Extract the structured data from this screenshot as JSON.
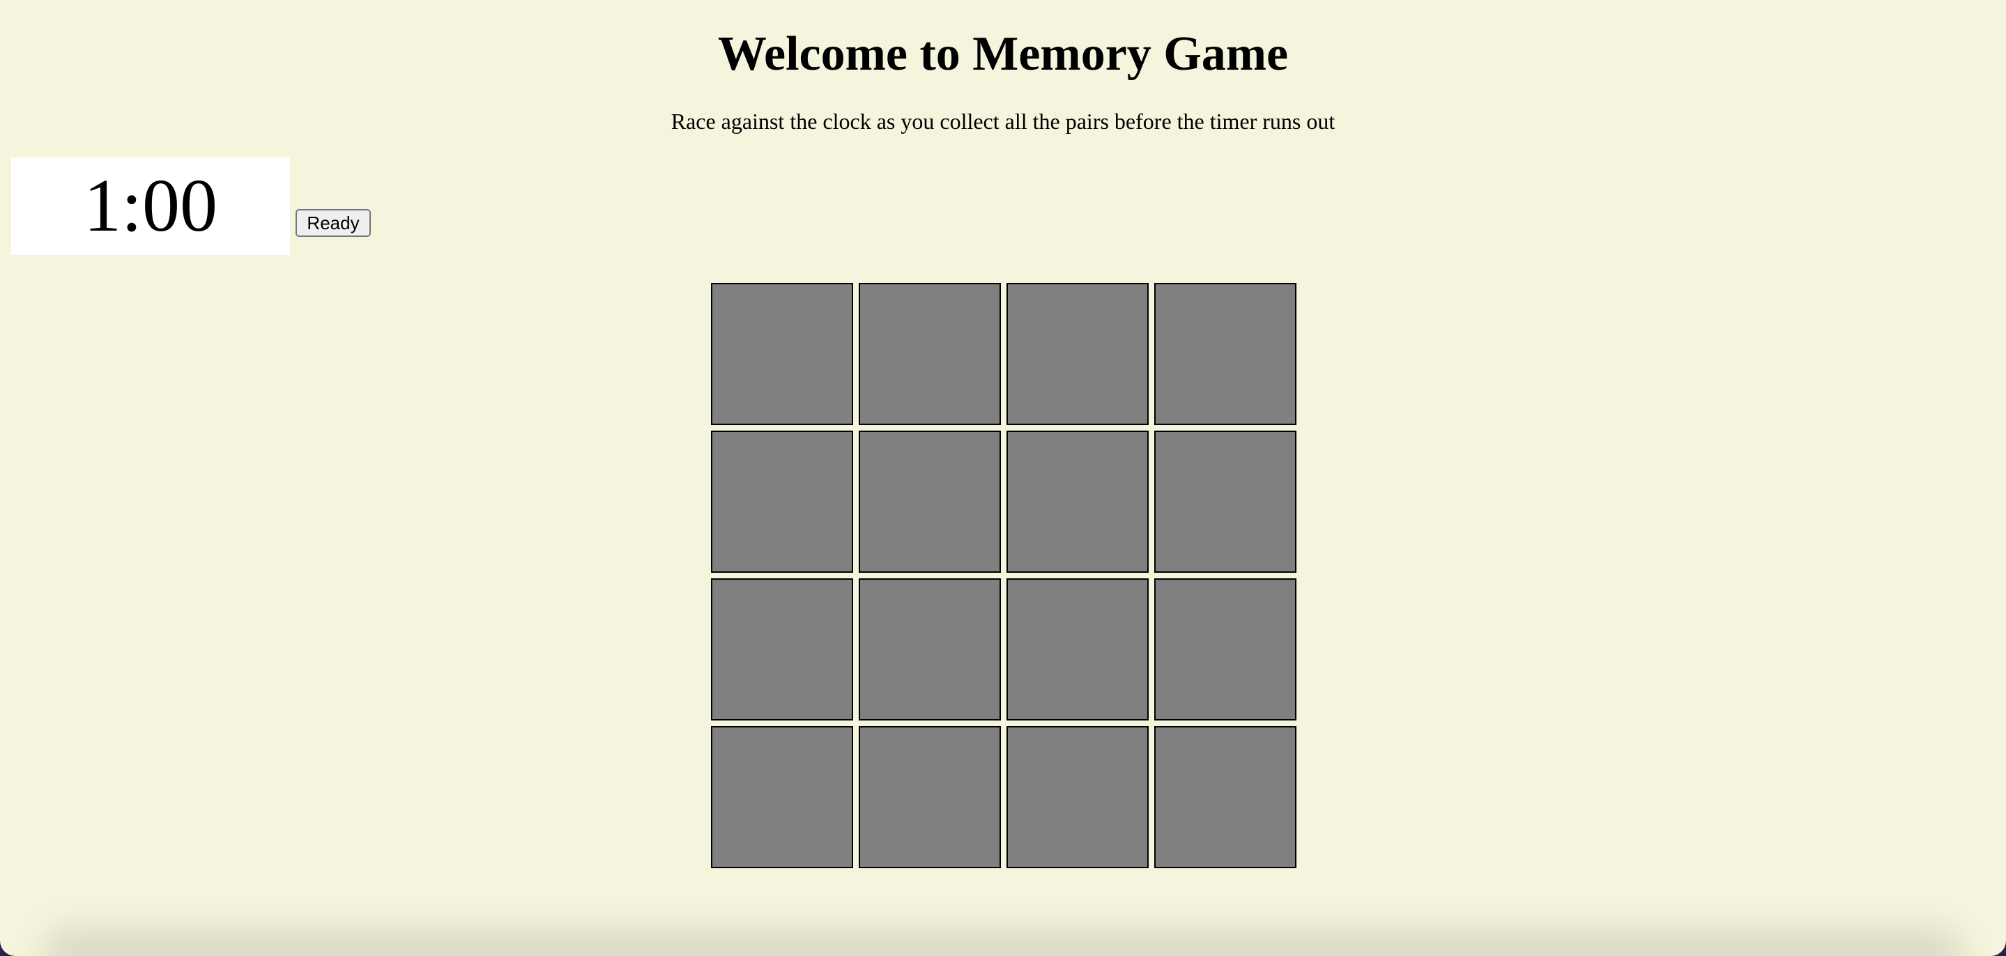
{
  "header": {
    "title": "Welcome to Memory Game",
    "subtitle": "Race against the clock as you collect all the pairs before the timer runs out"
  },
  "timer": {
    "display": "1:00"
  },
  "controls": {
    "ready_label": "Ready"
  },
  "board": {
    "rows": 4,
    "columns": 4,
    "card_count": 16,
    "cards_face_down": true,
    "card_back_color": "#808080"
  },
  "colors": {
    "background": "#f5f4dc",
    "timer_background": "#ffffff"
  }
}
